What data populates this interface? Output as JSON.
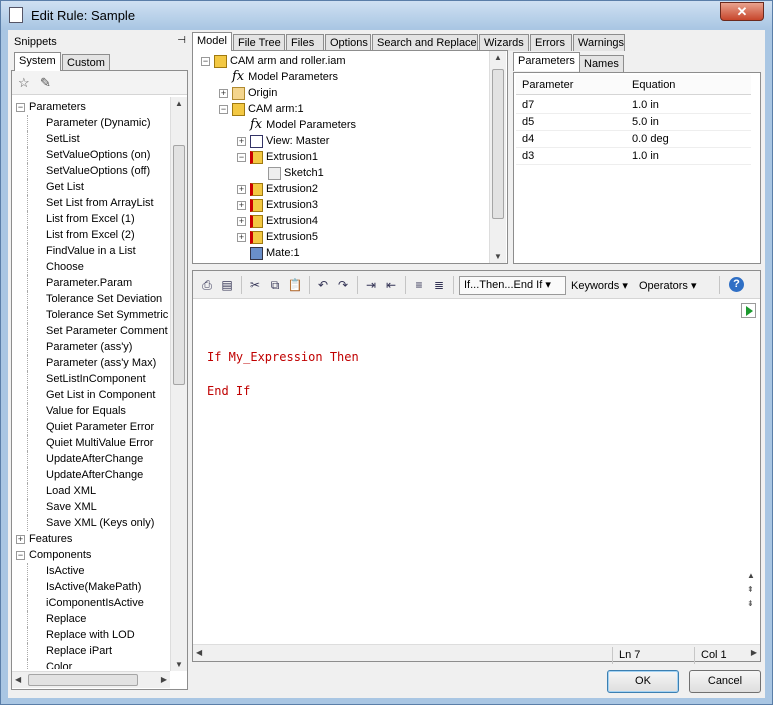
{
  "window": {
    "title": "Edit Rule: Sample",
    "close_glyph": "✕"
  },
  "snippets": {
    "header": "Snippets",
    "pin_glyph": "⊣",
    "tabs": [
      "System",
      "Custom"
    ],
    "toolbar_icons": [
      "add-snippet-icon",
      "edit-snippet-icon"
    ],
    "tree": [
      {
        "type": "group",
        "label": "Parameters",
        "expanded": true
      },
      {
        "type": "item",
        "label": "Parameter (Dynamic)"
      },
      {
        "type": "item",
        "label": "SetList"
      },
      {
        "type": "item",
        "label": "SetValueOptions (on)"
      },
      {
        "type": "item",
        "label": "SetValueOptions (off)"
      },
      {
        "type": "item",
        "label": "Get List"
      },
      {
        "type": "item",
        "label": "Set List from ArrayList"
      },
      {
        "type": "item",
        "label": "List from Excel (1)"
      },
      {
        "type": "item",
        "label": "List from Excel (2)"
      },
      {
        "type": "item",
        "label": "FindValue in a List"
      },
      {
        "type": "item",
        "label": "Choose"
      },
      {
        "type": "item",
        "label": "Parameter.Param"
      },
      {
        "type": "item",
        "label": "Tolerance Set Deviation"
      },
      {
        "type": "item",
        "label": "Tolerance Set Symmetric"
      },
      {
        "type": "item",
        "label": "Set Parameter Comment"
      },
      {
        "type": "item",
        "label": "Parameter (ass'y)"
      },
      {
        "type": "item",
        "label": "Parameter (ass'y Max)"
      },
      {
        "type": "item",
        "label": "SetListInComponent"
      },
      {
        "type": "item",
        "label": "Get List in Component"
      },
      {
        "type": "item",
        "label": "Value for Equals"
      },
      {
        "type": "item",
        "label": "Quiet Parameter Error"
      },
      {
        "type": "item",
        "label": "Quiet MultiValue Error"
      },
      {
        "type": "item",
        "label": "UpdateAfterChange"
      },
      {
        "type": "item",
        "label": "UpdateAfterChange"
      },
      {
        "type": "item",
        "label": "Load XML"
      },
      {
        "type": "item",
        "label": "Save XML"
      },
      {
        "type": "item",
        "label": "Save XML (Keys only)"
      },
      {
        "type": "group",
        "label": "Features",
        "expanded": false
      },
      {
        "type": "group",
        "label": "Components",
        "expanded": true
      },
      {
        "type": "item",
        "label": "IsActive"
      },
      {
        "type": "item",
        "label": "IsActive(MakePath)"
      },
      {
        "type": "item",
        "label": "iComponentIsActive"
      },
      {
        "type": "item",
        "label": "Replace"
      },
      {
        "type": "item",
        "label": "Replace with LOD"
      },
      {
        "type": "item",
        "label": "Replace iPart"
      },
      {
        "type": "item",
        "label": "Color"
      }
    ]
  },
  "model": {
    "tabs": [
      "Model",
      "File Tree",
      "Files",
      "Options",
      "Search and Replace",
      "Wizards",
      "Errors",
      "Warnings"
    ],
    "tree": [
      {
        "label": "CAM arm and roller.iam",
        "icon": "assembly-icon",
        "level": 0,
        "toggle": "-"
      },
      {
        "label": "Model Parameters",
        "icon": "fx-icon",
        "level": 1,
        "toggle": ""
      },
      {
        "label": "Origin",
        "icon": "folder-icon",
        "level": 1,
        "toggle": "+"
      },
      {
        "label": "CAM arm:1",
        "icon": "part-icon",
        "level": 1,
        "toggle": "-"
      },
      {
        "label": "Model Parameters",
        "icon": "fx-icon",
        "level": 2,
        "toggle": ""
      },
      {
        "label": "View: Master",
        "icon": "view-icon",
        "level": 2,
        "toggle": "+"
      },
      {
        "label": "Extrusion1",
        "icon": "extrusion-icon",
        "level": 2,
        "toggle": "-"
      },
      {
        "label": "Sketch1",
        "icon": "sketch-icon",
        "level": 3,
        "toggle": ""
      },
      {
        "label": "Extrusion2",
        "icon": "extrusion-icon",
        "level": 2,
        "toggle": "+"
      },
      {
        "label": "Extrusion3",
        "icon": "extrusion-icon",
        "level": 2,
        "toggle": "+"
      },
      {
        "label": "Extrusion4",
        "icon": "extrusion-icon",
        "level": 2,
        "toggle": "+"
      },
      {
        "label": "Extrusion5",
        "icon": "extrusion-icon",
        "level": 2,
        "toggle": "+"
      },
      {
        "label": "Mate:1",
        "icon": "mate-icon",
        "level": 2,
        "toggle": ""
      }
    ]
  },
  "parameters": {
    "tabs": [
      "Parameters",
      "Names"
    ],
    "headers": [
      "Parameter",
      "Equation"
    ],
    "rows": [
      {
        "name": "d7",
        "equation": "1.0 in"
      },
      {
        "name": "d5",
        "equation": "5.0 in"
      },
      {
        "name": "d4",
        "equation": "0.0 deg"
      },
      {
        "name": "d3",
        "equation": "1.0 in"
      }
    ]
  },
  "editor": {
    "toolbar": {
      "snippet_dropdown": "If...Then...End If",
      "keywords": "Keywords",
      "operators": "Operators",
      "help": "?"
    },
    "lines": [
      "If My_Expression Then",
      "",
      "End If"
    ],
    "code_color": "#c00000"
  },
  "status": {
    "line": "Ln 7",
    "col": "Col 1"
  },
  "buttons": {
    "ok": "OK",
    "cancel": "Cancel"
  }
}
